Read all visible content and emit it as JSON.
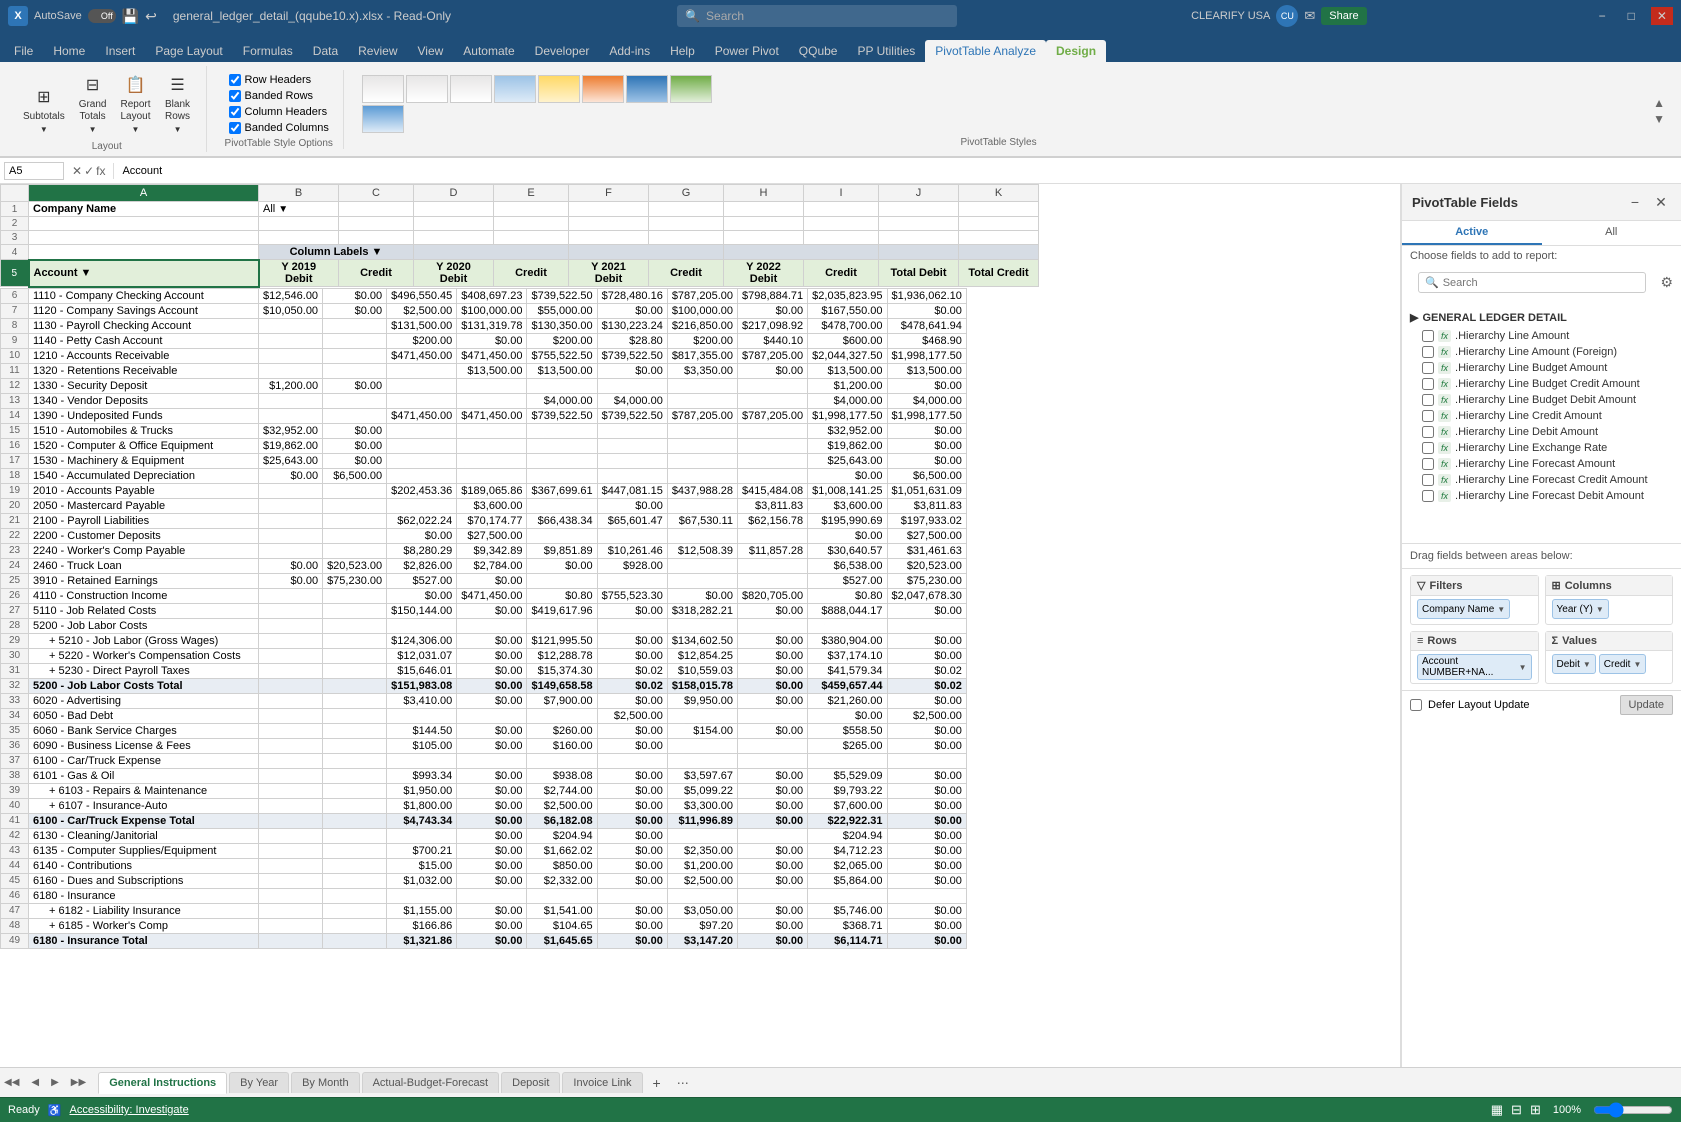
{
  "titleBar": {
    "appName": "Excel",
    "autosave": "AutoSave",
    "autosaveState": "Off",
    "filename": "general_ledger_detail_(qqube10.x).xlsx - Read-Only",
    "search": "Search",
    "userLabel": "CLEARIFY USA",
    "minimize": "−",
    "maximize": "□",
    "close": "✕"
  },
  "ribbonTabs": [
    "File",
    "Home",
    "Insert",
    "Page Layout",
    "Formulas",
    "Data",
    "Review",
    "View",
    "Automate",
    "Developer",
    "Add-ins",
    "Help",
    "Power Pivot",
    "QQube",
    "PP Utilities",
    "PivotTable Analyze",
    "Design"
  ],
  "ribbonGroups": {
    "layout": {
      "label": "Layout",
      "buttons": [
        "Subtotals",
        "Grand Totals",
        "Report Layout",
        "Blank Rows"
      ]
    },
    "styleOptions": {
      "label": "PivotTable Style Options",
      "checkboxes": [
        "Row Headers",
        "Banded Rows",
        "Column Headers",
        "Banded Columns"
      ]
    },
    "styles": {
      "label": "PivotTable Styles"
    }
  },
  "formulaBar": {
    "cellRef": "A5",
    "formula": "Account"
  },
  "colHeaders": [
    "A",
    "B",
    "C",
    "D",
    "E",
    "F",
    "G",
    "H",
    "I",
    "J",
    "K"
  ],
  "spreadsheet": {
    "companyName": "Company Name",
    "companyValue": "All",
    "columnLabels": "Column Labels",
    "years": [
      "Y 2019",
      "Y 2020",
      "Y 2021",
      "Y 2022",
      "Total Debit",
      "Total Credit"
    ],
    "subHeaders": [
      "Debit",
      "Credit",
      "Debit",
      "Credit",
      "Debit",
      "Credit",
      "Debit",
      "Credit"
    ],
    "rows": [
      {
        "num": 1,
        "a": "Company Name",
        "b": "",
        "c": "",
        "d": "",
        "e": "",
        "f": "",
        "g": "",
        "h": "",
        "i": "",
        "j": "",
        "k": ""
      },
      {
        "num": 2,
        "a": "",
        "b": "",
        "c": "",
        "d": "",
        "e": "",
        "f": "",
        "g": "",
        "h": "",
        "i": "",
        "j": "",
        "k": ""
      },
      {
        "num": 3,
        "a": "",
        "b": "",
        "c": "",
        "d": "",
        "e": "",
        "f": "",
        "g": "",
        "h": "",
        "i": "",
        "j": "",
        "k": ""
      },
      {
        "num": 4,
        "a": "",
        "b": "Column Labels",
        "c": "",
        "d": "",
        "e": "",
        "f": "",
        "g": "",
        "h": "",
        "i": "",
        "j": "",
        "k": ""
      },
      {
        "num": 5,
        "a": "Account",
        "b": "Y 2019",
        "c": "",
        "d": "Y 2020",
        "e": "",
        "f": "Y 2021",
        "g": "",
        "h": "Y 2022",
        "i": "",
        "j": "Total Debit",
        "k": "Total Credit"
      },
      {
        "num": 6,
        "a": "1110 - Company Checking Account",
        "b": "$12,546.00",
        "c": "$0.00",
        "d": "$496,550.45",
        "e": "$408,697.23",
        "f": "$739,522.50",
        "g": "$728,480.16",
        "h": "$787,205.00",
        "i": "$798,884.71",
        "j": "$2,035,823.95",
        "k": "$1,936,062.10"
      },
      {
        "num": 7,
        "a": "1120 - Company Savings Account",
        "b": "$10,050.00",
        "c": "$0.00",
        "d": "$2,500.00",
        "e": "$100,000.00",
        "f": "$55,000.00",
        "g": "$0.00",
        "h": "$100,000.00",
        "i": "$0.00",
        "j": "$167,550.00",
        "k": "$0.00"
      },
      {
        "num": 8,
        "a": "1130 - Payroll Checking Account",
        "b": "",
        "c": "",
        "d": "$131,500.00",
        "e": "$131,319.78",
        "f": "$130,350.00",
        "g": "$130,223.24",
        "h": "$216,850.00",
        "i": "$217,098.92",
        "j": "$478,700.00",
        "k": "$478,641.94"
      },
      {
        "num": 9,
        "a": "1140 - Petty Cash Account",
        "b": "",
        "c": "",
        "d": "$200.00",
        "e": "$0.00",
        "f": "$200.00",
        "g": "$28.80",
        "h": "$200.00",
        "i": "$440.10",
        "j": "$600.00",
        "k": "$468.90"
      },
      {
        "num": 10,
        "a": "1210 - Accounts Receivable",
        "b": "",
        "c": "",
        "d": "$471,450.00",
        "e": "$471,450.00",
        "f": "$755,522.50",
        "g": "$739,522.50",
        "h": "$817,355.00",
        "i": "$787,205.00",
        "j": "$2,044,327.50",
        "k": "$1,998,177.50"
      },
      {
        "num": 11,
        "a": "1320 - Retentions Receivable",
        "b": "",
        "c": "",
        "d": "",
        "e": "$13,500.00",
        "f": "$13,500.00",
        "g": "$0.00",
        "h": "$3,350.00",
        "i": "$0.00",
        "j": "$13,500.00",
        "k": "$13,500.00"
      },
      {
        "num": 12,
        "a": "1330 - Security Deposit",
        "b": "$1,200.00",
        "c": "$0.00",
        "d": "",
        "e": "",
        "f": "",
        "g": "",
        "h": "",
        "i": "",
        "j": "$1,200.00",
        "k": "$0.00"
      },
      {
        "num": 13,
        "a": "1340 - Vendor Deposits",
        "b": "",
        "c": "",
        "d": "",
        "e": "",
        "f": "$4,000.00",
        "g": "$4,000.00",
        "h": "",
        "i": "",
        "j": "$4,000.00",
        "k": "$4,000.00"
      },
      {
        "num": 14,
        "a": "1390 - Undeposited Funds",
        "b": "",
        "c": "",
        "d": "$471,450.00",
        "e": "$471,450.00",
        "f": "$739,522.50",
        "g": "$739,522.50",
        "h": "$787,205.00",
        "i": "$787,205.00",
        "j": "$1,998,177.50",
        "k": "$1,998,177.50"
      },
      {
        "num": 15,
        "a": "1510 - Automobiles & Trucks",
        "b": "$32,952.00",
        "c": "$0.00",
        "d": "",
        "e": "",
        "f": "",
        "g": "",
        "h": "",
        "i": "",
        "j": "$32,952.00",
        "k": "$0.00"
      },
      {
        "num": 16,
        "a": "1520 - Computer & Office Equipment",
        "b": "$19,862.00",
        "c": "$0.00",
        "d": "",
        "e": "",
        "f": "",
        "g": "",
        "h": "",
        "i": "",
        "j": "$19,862.00",
        "k": "$0.00"
      },
      {
        "num": 17,
        "a": "1530 - Machinery & Equipment",
        "b": "$25,643.00",
        "c": "$0.00",
        "d": "",
        "e": "",
        "f": "",
        "g": "",
        "h": "",
        "i": "",
        "j": "$25,643.00",
        "k": "$0.00"
      },
      {
        "num": 18,
        "a": "1540 - Accumulated Depreciation",
        "b": "$0.00",
        "c": "$6,500.00",
        "d": "",
        "e": "",
        "f": "",
        "g": "",
        "h": "",
        "i": "",
        "j": "$0.00",
        "k": "$6,500.00"
      },
      {
        "num": 19,
        "a": "2010 - Accounts Payable",
        "b": "",
        "c": "",
        "d": "$202,453.36",
        "e": "$189,065.86",
        "f": "$367,699.61",
        "g": "$447,081.15",
        "h": "$437,988.28",
        "i": "$415,484.08",
        "j": "$1,008,141.25",
        "k": "$1,051,631.09"
      },
      {
        "num": 20,
        "a": "2050 - Mastercard Payable",
        "b": "",
        "c": "",
        "d": "",
        "e": "$3,600.00",
        "f": "",
        "g": "$0.00",
        "h": "",
        "i": "$3,811.83",
        "j": "$3,600.00",
        "k": "$3,811.83"
      },
      {
        "num": 21,
        "a": "2100 - Payroll Liabilities",
        "b": "",
        "c": "",
        "d": "$62,022.24",
        "e": "$70,174.77",
        "f": "$66,438.34",
        "g": "$65,601.47",
        "h": "$67,530.11",
        "i": "$62,156.78",
        "j": "$195,990.69",
        "k": "$197,933.02"
      },
      {
        "num": 22,
        "a": "2200 - Customer Deposits",
        "b": "",
        "c": "",
        "d": "$0.00",
        "e": "$27,500.00",
        "f": "",
        "g": "",
        "h": "",
        "i": "",
        "j": "$0.00",
        "k": "$27,500.00"
      },
      {
        "num": 23,
        "a": "2240 - Worker's Comp Payable",
        "b": "",
        "c": "",
        "d": "$8,280.29",
        "e": "$9,342.89",
        "f": "$9,851.89",
        "g": "$10,261.46",
        "h": "$12,508.39",
        "i": "$11,857.28",
        "j": "$30,640.57",
        "k": "$31,461.63"
      },
      {
        "num": 24,
        "a": "2460 - Truck Loan",
        "b": "$0.00",
        "c": "$20,523.00",
        "d": "$2,826.00",
        "e": "$2,784.00",
        "f": "$0.00",
        "g": "$928.00",
        "h": "",
        "i": "",
        "j": "$6,538.00",
        "k": "$20,523.00"
      },
      {
        "num": 25,
        "a": "3910 - Retained Earnings",
        "b": "$0.00",
        "c": "$75,230.00",
        "d": "$527.00",
        "e": "$0.00",
        "f": "",
        "g": "",
        "h": "",
        "i": "",
        "j": "$527.00",
        "k": "$75,230.00"
      },
      {
        "num": 26,
        "a": "4110 - Construction Income",
        "b": "",
        "c": "",
        "d": "$0.00",
        "e": "$471,450.00",
        "f": "$0.80",
        "g": "$755,523.30",
        "h": "$0.00",
        "i": "$820,705.00",
        "j": "$0.80",
        "k": "$2,047,678.30"
      },
      {
        "num": 27,
        "a": "5110 - Job Related Costs",
        "b": "",
        "c": "",
        "d": "$150,144.00",
        "e": "$0.00",
        "f": "$419,617.96",
        "g": "$0.00",
        "h": "$318,282.21",
        "i": "$0.00",
        "j": "$888,044.17",
        "k": "$0.00"
      },
      {
        "num": 28,
        "a": "5200 - Job Labor Costs",
        "b": "",
        "c": "",
        "d": "",
        "e": "",
        "f": "",
        "g": "",
        "h": "",
        "i": "",
        "j": "",
        "k": ""
      },
      {
        "num": 29,
        "a": "+ 5210 - Job Labor (Gross Wages)",
        "b": "",
        "c": "",
        "d": "$124,306.00",
        "e": "$0.00",
        "f": "$121,995.50",
        "g": "$0.00",
        "h": "$134,602.50",
        "i": "$0.00",
        "j": "$380,904.00",
        "k": "$0.00"
      },
      {
        "num": 30,
        "a": "+ 5220 - Worker's Compensation Costs",
        "b": "",
        "c": "",
        "d": "$12,031.07",
        "e": "$0.00",
        "f": "$12,288.78",
        "g": "$0.00",
        "h": "$12,854.25",
        "i": "$0.00",
        "j": "$37,174.10",
        "k": "$0.00"
      },
      {
        "num": 31,
        "a": "+ 5230 - Direct Payroll Taxes",
        "b": "",
        "c": "",
        "d": "$15,646.01",
        "e": "$0.00",
        "f": "$15,374.30",
        "g": "$0.02",
        "h": "$10,559.03",
        "i": "$0.00",
        "j": "$41,579.34",
        "k": "$0.02"
      },
      {
        "num": 32,
        "a": "5200 - Job Labor Costs Total",
        "b": "",
        "c": "",
        "d": "$151,983.08",
        "e": "$0.00",
        "f": "$149,658.58",
        "g": "$0.02",
        "h": "$158,015.78",
        "i": "$0.00",
        "j": "$459,657.44",
        "k": "$0.02"
      },
      {
        "num": 33,
        "a": "6020 - Advertising",
        "b": "",
        "c": "",
        "d": "$3,410.00",
        "e": "$0.00",
        "f": "$7,900.00",
        "g": "$0.00",
        "h": "$9,950.00",
        "i": "$0.00",
        "j": "$21,260.00",
        "k": "$0.00"
      },
      {
        "num": 34,
        "a": "6050 - Bad Debt",
        "b": "",
        "c": "",
        "d": "",
        "e": "",
        "f": "",
        "g": "$2,500.00",
        "h": "",
        "i": "",
        "j": "$0.00",
        "k": "$2,500.00"
      },
      {
        "num": 35,
        "a": "6060 - Bank Service Charges",
        "b": "",
        "c": "",
        "d": "$144.50",
        "e": "$0.00",
        "f": "$260.00",
        "g": "$0.00",
        "h": "$154.00",
        "i": "$0.00",
        "j": "$558.50",
        "k": "$0.00"
      },
      {
        "num": 36,
        "a": "6090 - Business License & Fees",
        "b": "",
        "c": "",
        "d": "$105.00",
        "e": "$0.00",
        "f": "$160.00",
        "g": "$0.00",
        "h": "",
        "i": "",
        "j": "$265.00",
        "k": "$0.00"
      },
      {
        "num": 37,
        "a": "6100 - Car/Truck Expense",
        "b": "",
        "c": "",
        "d": "",
        "e": "",
        "f": "",
        "g": "",
        "h": "",
        "i": "",
        "j": "",
        "k": ""
      },
      {
        "num": 38,
        "a": "6101 - Gas & Oil",
        "b": "",
        "c": "",
        "d": "$993.34",
        "e": "$0.00",
        "f": "$938.08",
        "g": "$0.00",
        "h": "$3,597.67",
        "i": "$0.00",
        "j": "$5,529.09",
        "k": "$0.00"
      },
      {
        "num": 39,
        "a": "+ 6103 - Repairs & Maintenance",
        "b": "",
        "c": "",
        "d": "$1,950.00",
        "e": "$0.00",
        "f": "$2,744.00",
        "g": "$0.00",
        "h": "$5,099.22",
        "i": "$0.00",
        "j": "$9,793.22",
        "k": "$0.00"
      },
      {
        "num": 40,
        "a": "+ 6107 - Insurance-Auto",
        "b": "",
        "c": "",
        "d": "$1,800.00",
        "e": "$0.00",
        "f": "$2,500.00",
        "g": "$0.00",
        "h": "$3,300.00",
        "i": "$0.00",
        "j": "$7,600.00",
        "k": "$0.00"
      },
      {
        "num": 41,
        "a": "6100 - Car/Truck Expense Total",
        "b": "",
        "c": "",
        "d": "$4,743.34",
        "e": "$0.00",
        "f": "$6,182.08",
        "g": "$0.00",
        "h": "$11,996.89",
        "i": "$0.00",
        "j": "$22,922.31",
        "k": "$0.00"
      },
      {
        "num": 42,
        "a": "6130 - Cleaning/Janitorial",
        "b": "",
        "c": "",
        "d": "",
        "e": "$0.00",
        "f": "$204.94",
        "g": "$0.00",
        "h": "",
        "i": "",
        "j": "$204.94",
        "k": "$0.00"
      },
      {
        "num": 43,
        "a": "6135 - Computer Supplies/Equipment",
        "b": "",
        "c": "",
        "d": "$700.21",
        "e": "$0.00",
        "f": "$1,662.02",
        "g": "$0.00",
        "h": "$2,350.00",
        "i": "$0.00",
        "j": "$4,712.23",
        "k": "$0.00"
      },
      {
        "num": 44,
        "a": "6140 - Contributions",
        "b": "",
        "c": "",
        "d": "$15.00",
        "e": "$0.00",
        "f": "$850.00",
        "g": "$0.00",
        "h": "$1,200.00",
        "i": "$0.00",
        "j": "$2,065.00",
        "k": "$0.00"
      },
      {
        "num": 45,
        "a": "6160 - Dues and Subscriptions",
        "b": "",
        "c": "",
        "d": "$1,032.00",
        "e": "$0.00",
        "f": "$2,332.00",
        "g": "$0.00",
        "h": "$2,500.00",
        "i": "$0.00",
        "j": "$5,864.00",
        "k": "$0.00"
      },
      {
        "num": 46,
        "a": "6180 - Insurance",
        "b": "",
        "c": "",
        "d": "",
        "e": "",
        "f": "",
        "g": "",
        "h": "",
        "i": "",
        "j": "",
        "k": ""
      },
      {
        "num": 47,
        "a": "+ 6182 - Liability Insurance",
        "b": "",
        "c": "",
        "d": "$1,155.00",
        "e": "$0.00",
        "f": "$1,541.00",
        "g": "$0.00",
        "h": "$3,050.00",
        "i": "$0.00",
        "j": "$5,746.00",
        "k": "$0.00"
      },
      {
        "num": 48,
        "a": "+ 6185 - Worker's Comp",
        "b": "",
        "c": "",
        "d": "$166.86",
        "e": "$0.00",
        "f": "$104.65",
        "g": "$0.00",
        "h": "$97.20",
        "i": "$0.00",
        "j": "$368.71",
        "k": "$0.00"
      },
      {
        "num": 49,
        "a": "6180 - Insurance Total",
        "b": "",
        "c": "",
        "d": "$1,321.86",
        "e": "$0.00",
        "f": "$1,645.65",
        "g": "$0.00",
        "h": "$3,147.20",
        "i": "$0.00",
        "j": "$6,114.71",
        "k": "$0.00"
      }
    ]
  },
  "sheetTabs": [
    "General Instructions",
    "By Year",
    "By Month",
    "Actual-Budget-Forecast",
    "Deposit",
    "Invoice Link"
  ],
  "activeSheet": "General Instructions",
  "pivotPanel": {
    "title": "PivotTable Fields",
    "tabs": [
      "Active",
      "All"
    ],
    "activeTab": "Active",
    "searchPlaceholder": "Search",
    "chooseFieldsLabel": "Choose fields to add to report:",
    "fieldGroups": [
      {
        "name": "GENERAL LEDGER DETAIL",
        "fields": [
          {
            "label": "Hierarchy Line Amount",
            "checked": false
          },
          {
            "label": "Hierarchy Line Amount (Foreign)",
            "checked": false
          },
          {
            "label": "Hierarchy Line Budget Amount",
            "checked": false
          },
          {
            "label": "Hierarchy Line Budget Credit Amount",
            "checked": false
          },
          {
            "label": "Hierarchy Line Budget Debit Amount",
            "checked": false
          },
          {
            "label": "Hierarchy Line Credit Amount",
            "checked": false
          },
          {
            "label": "Hierarchy Line Debit Amount",
            "checked": false
          },
          {
            "label": "Hierarchy Line Exchange Rate",
            "checked": false
          },
          {
            "label": "Hierarchy Line Forecast Amount",
            "checked": false
          },
          {
            "label": "Hierarchy Line Forecast Credit Amount",
            "checked": false
          },
          {
            "label": "Hierarchy Line Forecast Debit Amount",
            "checked": false
          }
        ]
      }
    ],
    "areas": {
      "filters": {
        "label": "Filters",
        "icon": "filter",
        "chips": [
          {
            "label": "Company Name",
            "hasDropdown": true
          }
        ]
      },
      "columns": {
        "label": "Columns",
        "icon": "columns",
        "chips": [
          {
            "label": "Year (Y)",
            "hasDropdown": true
          }
        ]
      },
      "rows": {
        "label": "Rows",
        "icon": "rows",
        "chips": [
          {
            "label": "Account NUMBER+NA...",
            "hasDropdown": true
          }
        ]
      },
      "values": {
        "label": "Values",
        "icon": "sigma",
        "chips": [
          {
            "label": "Debit",
            "hasDropdown": true
          },
          {
            "label": "Credit",
            "hasDropdown": true
          }
        ]
      }
    },
    "deferUpdate": "Defer Layout Update",
    "updateBtn": "Update"
  },
  "statusBar": {
    "ready": "Ready",
    "accessibility": "Accessibility: Investigate",
    "zoom": "100%"
  }
}
